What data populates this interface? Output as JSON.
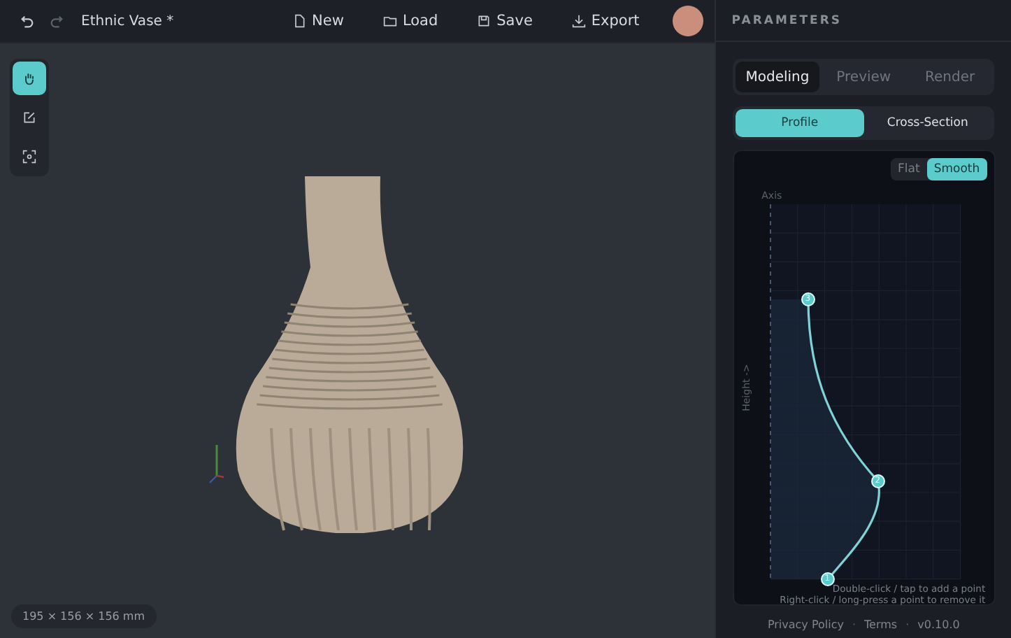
{
  "topbar": {
    "title": "Ethnic Vase *",
    "actions": [
      {
        "kind": "new",
        "label": "New"
      },
      {
        "kind": "load",
        "label": "Load"
      },
      {
        "kind": "save",
        "label": "Save"
      },
      {
        "kind": "export",
        "label": "Export"
      }
    ]
  },
  "tools": [
    {
      "kind": "hand",
      "selected": true
    },
    {
      "kind": "edit",
      "selected": false
    },
    {
      "kind": "focus",
      "selected": false
    }
  ],
  "dimensions": "195 × 156 × 156 mm",
  "panel": {
    "title": "PARAMETERS",
    "tabs": [
      {
        "label": "Modeling",
        "selected": true
      },
      {
        "label": "Preview",
        "selected": false
      },
      {
        "label": "Render",
        "selected": false
      }
    ],
    "subtabs": [
      {
        "label": "Profile",
        "selected": true
      },
      {
        "label": "Cross-Section",
        "selected": false
      }
    ],
    "modes": [
      {
        "label": "Flat",
        "selected": false
      },
      {
        "label": "Smooth",
        "selected": true
      }
    ],
    "axis_label": "Axis",
    "height_label": "Height ->",
    "points": [
      {
        "label": "1"
      },
      {
        "label": "2"
      },
      {
        "label": "3"
      }
    ],
    "hints": [
      "Double-click / tap to add a point",
      "Right-click / long-press a point to remove it"
    ]
  },
  "footer": [
    {
      "kind": "link",
      "text": "Privacy Policy"
    },
    {
      "kind": "separator",
      "text": "·"
    },
    {
      "kind": "link",
      "text": "Terms"
    },
    {
      "kind": "separator",
      "text": "·"
    },
    {
      "kind": "version",
      "text": "v0.10.0"
    }
  ]
}
